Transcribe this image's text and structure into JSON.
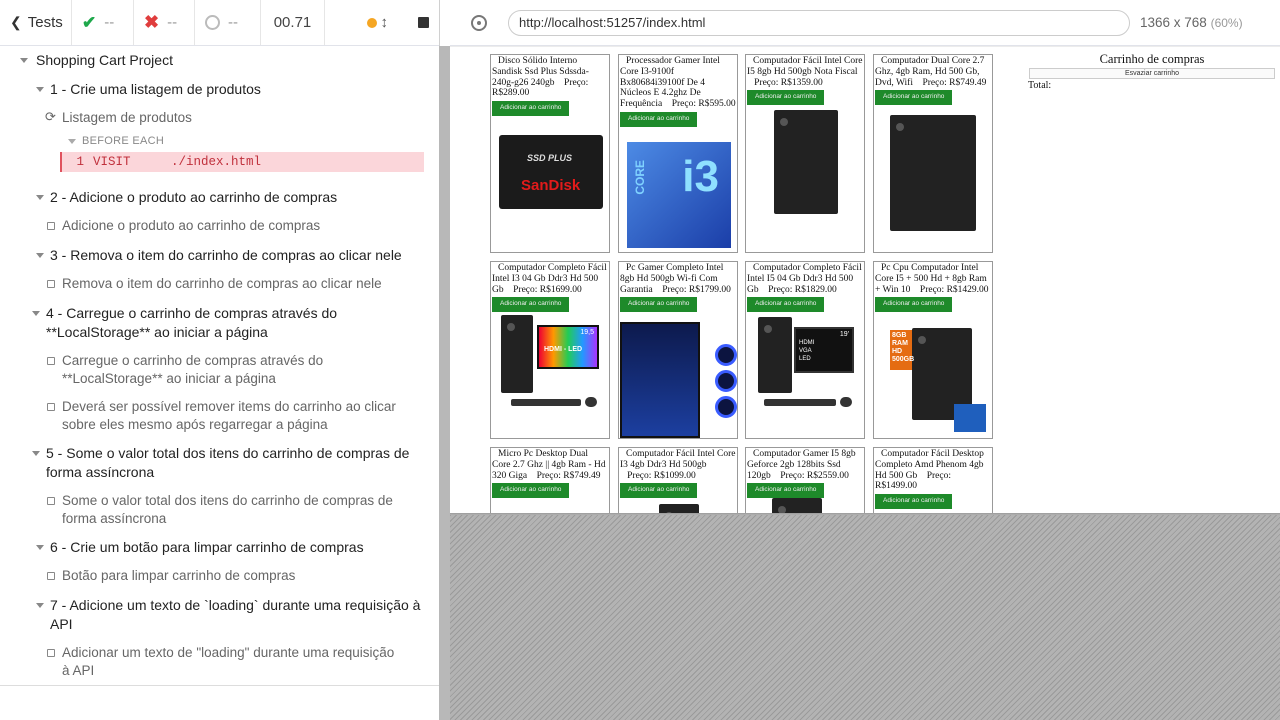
{
  "toolbar": {
    "tests_label": "Tests",
    "passed": "--",
    "failed": "--",
    "pending": "--",
    "duration": "00.71"
  },
  "tree": {
    "project": "Shopping Cart Project",
    "suites": [
      {
        "title": "1 - Crie uma listagem de produtos",
        "test": "Listagem de produtos",
        "hook": "BEFORE EACH",
        "cmd_num": "1",
        "cmd_name": "VISIT",
        "cmd_arg": "./index.html"
      },
      {
        "title": "2 - Adicione o produto ao carrinho de compras",
        "test": "Adicione o produto ao carrinho de compras"
      },
      {
        "title": "3 - Remova o item do carrinho de compras ao clicar nele",
        "test": "Remova o item do carrinho de compras ao clicar nele"
      },
      {
        "title_l1": "4 - Carregue o carrinho de compras através do",
        "title_l2": "**LocalStorage** ao iniciar a página",
        "test1_l1": "Carregue o carrinho de compras através do",
        "test1_l2": "**LocalStorage** ao iniciar a página",
        "test2_l1": "Deverá ser possível remover items do carrinho ao clicar",
        "test2_l2": "sobre eles mesmo após regarregar a página"
      },
      {
        "title_l1": "5 - Some o valor total dos itens do carrinho de compras de",
        "title_l2": "forma assíncrona",
        "test_l1": "Some o valor total dos itens do carrinho de compras de",
        "test_l2": "forma assíncrona"
      },
      {
        "title": "6 - Crie um botão para limpar carrinho de compras",
        "test": "Botão para limpar carrinho de compras"
      },
      {
        "title_l1": "7 - Adicione um texto de `loading` durante uma requisição à",
        "title_l2": "API",
        "test_l1": "Adicionar um texto de \"loading\" durante uma requisição",
        "test_l2": "à API"
      }
    ]
  },
  "browser": {
    "url": "http://localhost:51257/index.html",
    "viewport": "1366 x 768",
    "scale": "(60%)"
  },
  "products": [
    {
      "title": "Disco Sólido Interno Sandisk Ssd Plus Sdssda-240g-g26 240gb",
      "price_label": "Preço:",
      "price": "R$289.00",
      "art": "ssd",
      "art_text_a": "SSD PLUS",
      "art_text_b": "SanDisk"
    },
    {
      "title": "Processador Gamer Intel Core I3-9100f Bx80684i39100f De 4 Núcleos E 4.2ghz De Frequência",
      "price_label": "Preço:",
      "price": "R$595.00",
      "art": "i3",
      "art_text_a": "CORE",
      "art_text_b": "i3"
    },
    {
      "title": "Computador Fácil Intel Core I5 8gb Hd 500gb Nota Fiscal",
      "price_label": "Preço:",
      "price": "R$1359.00",
      "art": "tower"
    },
    {
      "title": "Computador Dual Core 2.7 Ghz, 4gb Ram, Hd 500 Gb, Dvd, Wifi",
      "price_label": "Preço:",
      "price": "R$749.49",
      "art": "tower"
    },
    {
      "title": "Computador Completo Fácil Intel I3 04 Gb Ddr3 Hd 500 Gb",
      "price_label": "Preço:",
      "price": "R$1699.00",
      "art": "set_rgb",
      "art_text_a": "19,5",
      "art_text_b": "HDMI - LED"
    },
    {
      "title": "Pc Gamer Completo Intel 8gb Hd 500gb Wi-fi Com Garantia",
      "price_label": "Preço:",
      "price": "R$1799.00",
      "art": "gamer"
    },
    {
      "title": "Computador Completo Fácil Intel I5 04 Gb Ddr3 Hd 500 Gb",
      "price_label": "Preço:",
      "price": "R$1829.00",
      "art": "set_dark",
      "art_text_a": "19'",
      "art_text_b": "HDMI VGA LED"
    },
    {
      "title": "Pc Cpu Computador Intel Core I5 + 500 Hd + 8gb Ram + Win 10",
      "price_label": "Preço:",
      "price": "R$1429.00",
      "art": "box",
      "art_text_a": "8GB RAM HD 500GB"
    },
    {
      "title": "Micro Pc Desktop Dual Core 2.7 Ghz || 4gb Ram - Hd 320 Giga",
      "price_label": "Preço:",
      "price": "R$749.49",
      "art": "none"
    },
    {
      "title": "Computador Fácil Intel Core I3 4gb Ddr3 Hd 500gb",
      "price_label": "Preço:",
      "price": "R$1099.00",
      "art": "none"
    },
    {
      "title": "Computador Gamer I5 8gb Geforce 2gb 128bits Ssd 120gb",
      "price_label": "Preço:",
      "price": "R$2559.00",
      "art": "none"
    },
    {
      "title": "Computador Fácil Desktop Completo Amd Phenom 4gb Hd 500 Gb",
      "price_label": "Preço:",
      "price": "R$1499.00",
      "art": "none"
    }
  ],
  "add_button_label": "Adicionar ao carrinho",
  "cart": {
    "title": "Carrinho de compras",
    "empty_button": "Esvaziar carrinho",
    "total_label": "Total:"
  },
  "colors": {
    "pass": "#1ea84b",
    "fail": "#e03d3d",
    "running": "#f5a623",
    "add_button": "#1e8a2a"
  }
}
